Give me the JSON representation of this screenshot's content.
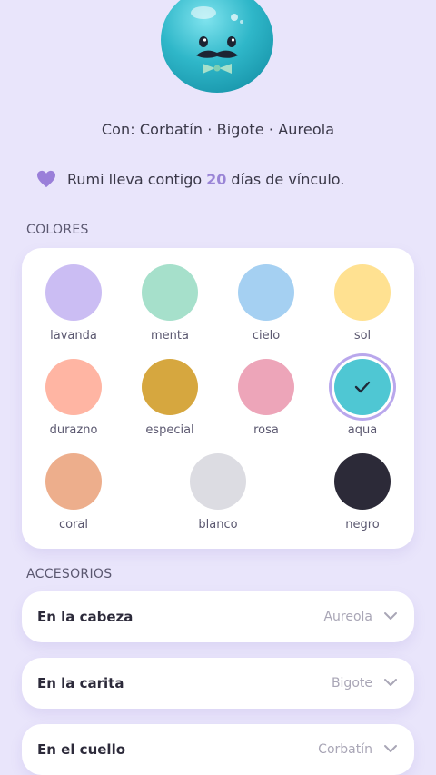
{
  "pet": {
    "with_line": "Con: Corbatín · Bigote · Aureola",
    "bond_prefix": "Rumi lleva contigo",
    "bond_days": "20",
    "bond_suffix": "días de vínculo."
  },
  "colors": {
    "section_title": "COLORES",
    "items": [
      {
        "label": "lavanda",
        "hex": "#cbbdf3",
        "selected": false
      },
      {
        "label": "menta",
        "hex": "#a6e0cb",
        "selected": false
      },
      {
        "label": "cielo",
        "hex": "#a5d0f2",
        "selected": false
      },
      {
        "label": "sol",
        "hex": "#ffe191",
        "selected": false
      },
      {
        "label": "durazno",
        "hex": "#ffb5a3",
        "selected": false
      },
      {
        "label": "especial",
        "hex": "#d6a73f",
        "selected": false
      },
      {
        "label": "rosa",
        "hex": "#eda5b9",
        "selected": false
      },
      {
        "label": "aqua",
        "hex": "#4fc7d3",
        "selected": true
      },
      {
        "label": "coral",
        "hex": "#edae8c",
        "selected": false
      },
      {
        "label": "blanco",
        "hex": "#dcdce2",
        "selected": false
      },
      {
        "label": "negro",
        "hex": "#2c2a38",
        "selected": false
      }
    ]
  },
  "accessories": {
    "section_title": "ACCESORIOS",
    "items": [
      {
        "title": "En la cabeza",
        "value": "Aureola"
      },
      {
        "title": "En la carita",
        "value": "Bigote"
      },
      {
        "title": "En el cuello",
        "value": "Corbatín"
      }
    ]
  },
  "theme": {
    "background": "#e9e5fb",
    "accent": "#9a85d6",
    "heart": "#9a7fd9"
  }
}
